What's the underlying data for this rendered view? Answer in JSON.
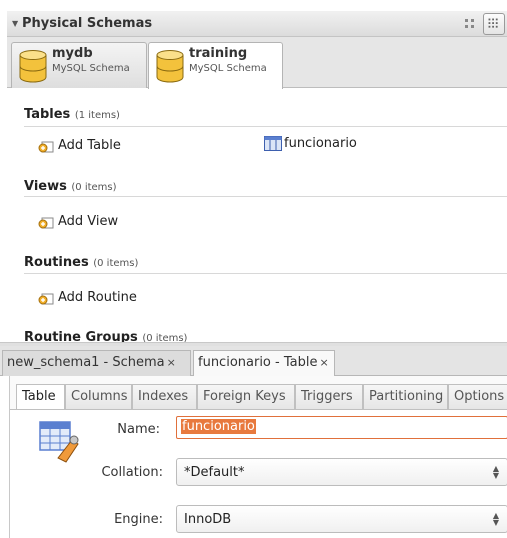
{
  "panel": {
    "title": "Physical Schemas"
  },
  "schemas": [
    {
      "name": "mydb",
      "type": "MySQL Schema",
      "active": false
    },
    {
      "name": "training",
      "type": "MySQL Schema",
      "active": true
    }
  ],
  "sections": {
    "tables": {
      "title": "Tables",
      "count": "(1 items)",
      "add_label": "Add Table",
      "items": [
        "funcionario"
      ]
    },
    "views": {
      "title": "Views",
      "count": "(0 items)",
      "add_label": "Add View"
    },
    "routines": {
      "title": "Routines",
      "count": "(0 items)",
      "add_label": "Add Routine"
    },
    "routine_groups": {
      "title": "Routine Groups",
      "count": "(0 items)"
    }
  },
  "editor_tabs": [
    {
      "label": "new_schema1 - Schema",
      "close": "×",
      "active": false
    },
    {
      "label": "funcionario - Table",
      "close": "×",
      "active": true
    }
  ],
  "inner_tabs": [
    "Table",
    "Columns",
    "Indexes",
    "Foreign Keys",
    "Triggers",
    "Partitioning",
    "Options"
  ],
  "form": {
    "name_label": "Name:",
    "name_value": "funcionario",
    "collation_label": "Collation:",
    "collation_value": "*Default*",
    "engine_label": "Engine:",
    "engine_value": "InnoDB"
  },
  "colors": {
    "focus_border": "#e0703b",
    "selection": "#e8793d",
    "db_icon": "#f3c23c",
    "table_icon": "#5a7fd0"
  },
  "icons": {
    "collapse": "triangle-down-icon",
    "small_view": "small-icons-view-icon",
    "large_view": "large-icons-view-icon",
    "database": "database-icon",
    "add": "add-item-icon",
    "table": "table-icon",
    "table_editor": "table-edit-icon"
  }
}
